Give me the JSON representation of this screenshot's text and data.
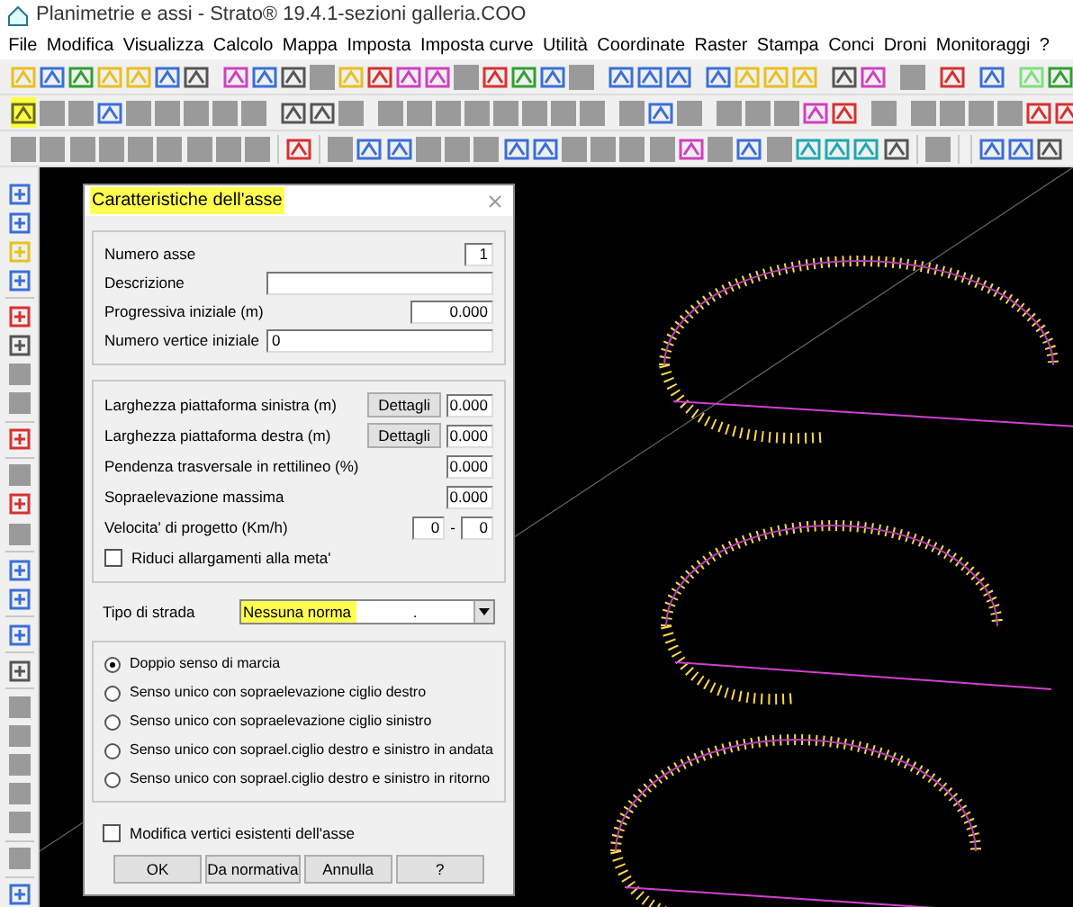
{
  "window": {
    "title": "Planimetrie e assi - Strato® 19.4.1-sezioni galleria.COO"
  },
  "menu": [
    "File",
    "Modifica",
    "Visualizza",
    "Calcolo",
    "Mappa",
    "Imposta",
    "Imposta curve",
    "Utilità",
    "Coordinate",
    "Raster",
    "Stampa",
    "Conci",
    "Droni",
    "Monitoraggi",
    "?"
  ],
  "dialog": {
    "title": "Caratteristiche dell'asse",
    "general": [
      {
        "label": "Numero asse",
        "value": "1",
        "kind": "short"
      },
      {
        "label": "Descrizione",
        "kind": "wide"
      },
      {
        "label": "Progressiva iniziale (m)",
        "value": "0.000",
        "kind": "medium"
      },
      {
        "label": "Numero vertice iniziale",
        "value": "0",
        "kind": "left"
      }
    ],
    "platform": [
      {
        "label": "Larghezza piattaforma sinistra (m)",
        "button": "Dettagli",
        "value": "0.000",
        "kind": "button"
      },
      {
        "label": "Larghezza piattaforma destra (m)",
        "button": "Dettagli",
        "value": "0.000",
        "kind": "button"
      },
      {
        "label": "Pendenza trasversale in rettilineo (%)",
        "value": "0.000",
        "kind": "value"
      },
      {
        "label": "Sopraelevazione massima",
        "value": "0.000",
        "kind": "value"
      },
      {
        "label": "Velocita' di progetto (Km/h)",
        "value": "0",
        "value2": "0",
        "separator": "-",
        "kind": "range"
      },
      {
        "label": "Riduci allargamenti alla meta'",
        "checked": false,
        "kind": "checkbox"
      }
    ],
    "road_type": {
      "label": "Tipo di strada",
      "value": "Nessuna norma",
      "suffix": "."
    },
    "direction": [
      {
        "label": "Doppio senso di marcia",
        "selected": true
      },
      {
        "label": "Senso unico con sopraelevazione ciglio destro",
        "selected": false
      },
      {
        "label": "Senso unico con sopraelevazione ciglio sinistro",
        "selected": false
      },
      {
        "label": "Senso unico con soprael.ciglio destro e sinistro in andata",
        "selected": false
      },
      {
        "label": "Senso unico con soprael.ciglio destro e sinistro in ritorno",
        "selected": false
      }
    ],
    "modify_vertices": {
      "label": "Modifica vertici esistenti dell'asse",
      "checked": false
    },
    "buttons": [
      "OK",
      "Da normativa",
      "Annulla",
      "?"
    ]
  }
}
